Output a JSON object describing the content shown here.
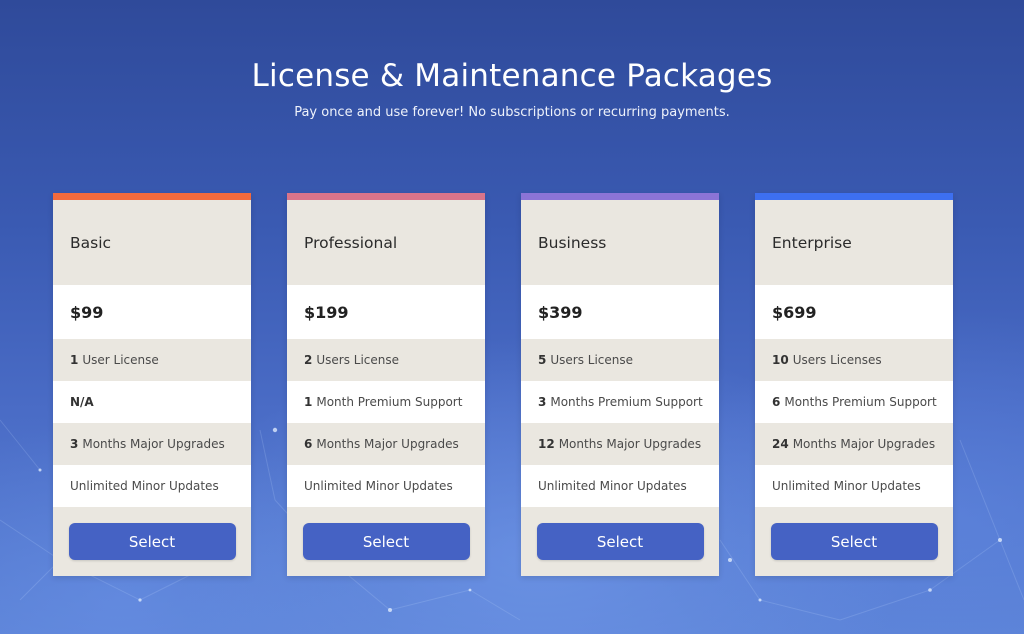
{
  "header": {
    "title": "License & Maintenance Packages",
    "subtitle": "Pay once and use forever! No subscriptions or recurring payments."
  },
  "plans": [
    {
      "name": "Basic",
      "accent_color": "#f26a3d",
      "price": "$99",
      "license": {
        "qty": "1",
        "text": "User License"
      },
      "support": {
        "qty": "",
        "text": "N/A"
      },
      "upgrades": {
        "qty": "3",
        "text": "Months Major Upgrades"
      },
      "updates": "Unlimited Minor Updates",
      "button": "Select"
    },
    {
      "name": "Professional",
      "accent_color": "#d9748a",
      "price": "$199",
      "license": {
        "qty": "2",
        "text": "Users License"
      },
      "support": {
        "qty": "1",
        "text": "Month Premium Support"
      },
      "upgrades": {
        "qty": "6",
        "text": "Months Major Upgrades"
      },
      "updates": "Unlimited Minor Updates",
      "button": "Select"
    },
    {
      "name": "Business",
      "accent_color": "#8b74d6",
      "price": "$399",
      "license": {
        "qty": "5",
        "text": "Users License"
      },
      "support": {
        "qty": "3",
        "text": "Months Premium Support"
      },
      "upgrades": {
        "qty": "12",
        "text": "Months Major Upgrades"
      },
      "updates": "Unlimited Minor Updates",
      "button": "Select"
    },
    {
      "name": "Enterprise",
      "accent_color": "#3d6ff0",
      "price": "$699",
      "license": {
        "qty": "10",
        "text": "Users Licenses"
      },
      "support": {
        "qty": "6",
        "text": "Months Premium Support"
      },
      "upgrades": {
        "qty": "24",
        "text": "Months Major Upgrades"
      },
      "updates": "Unlimited Minor Updates",
      "button": "Select"
    }
  ],
  "colors": {
    "button": "#4562c4",
    "card_gray": "#eae7e0"
  }
}
